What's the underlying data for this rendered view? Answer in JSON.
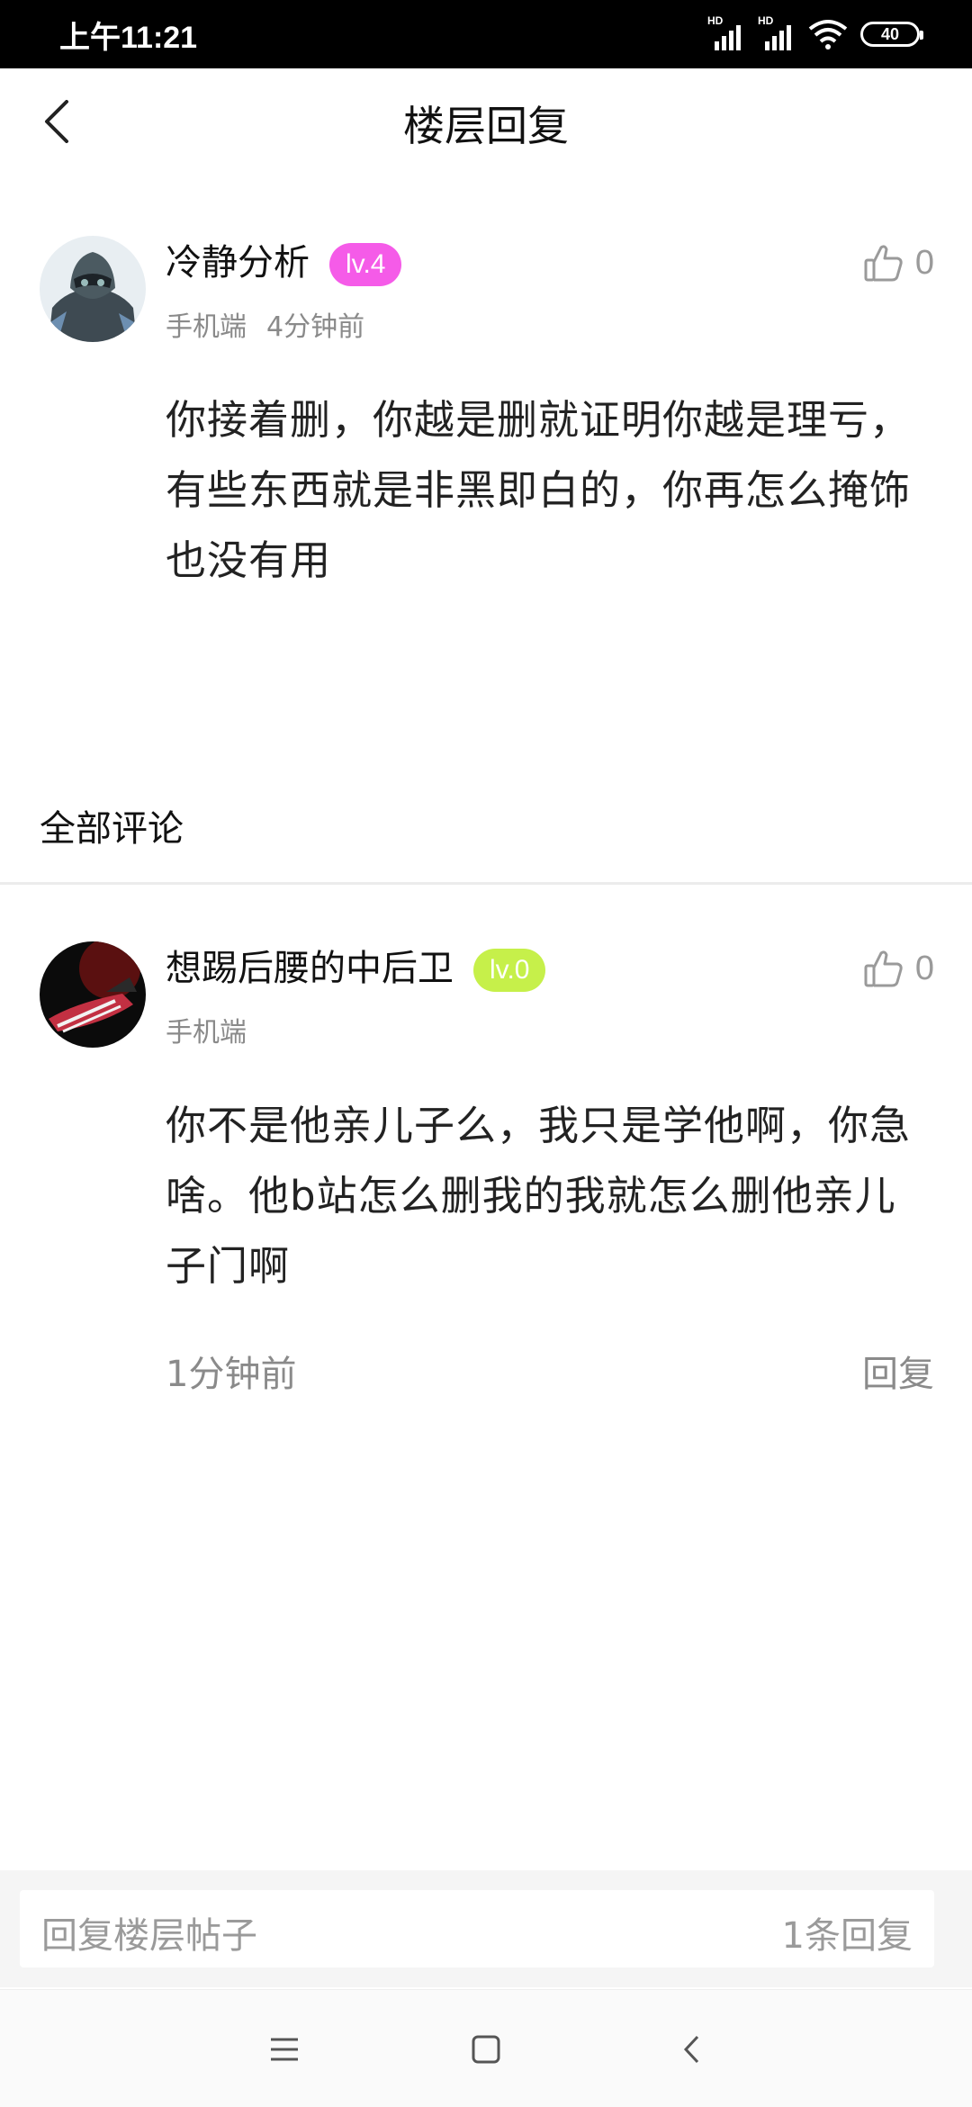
{
  "status_bar": {
    "time": "上午11:21",
    "hd1": "HD",
    "hd2": "HD",
    "battery": "40"
  },
  "header": {
    "title": "楼层回复"
  },
  "main_post": {
    "username": "冷静分析",
    "level": "lv.4",
    "level_color": "#f55be8",
    "device": "手机端",
    "time_ago": "4分钟前",
    "likes": "0",
    "content": "你接着删，你越是删就证明你越是理亏，有些东西就是非黑即白的，你再怎么掩饰也没有用"
  },
  "section_title": "全部评论",
  "comments": [
    {
      "username": "想踢后腰的中后卫",
      "level": "lv.0",
      "level_color": "#c6f04a",
      "device": "手机端",
      "likes": "0",
      "content": "你不是他亲儿子么，我只是学他啊，你急啥。他b站怎么删我的我就怎么删他亲儿子门啊",
      "time_ago": "1分钟前",
      "reply_label": "回复"
    }
  ],
  "bottom_bar": {
    "placeholder": "回复楼层帖子",
    "reply_count": "1条回复"
  }
}
